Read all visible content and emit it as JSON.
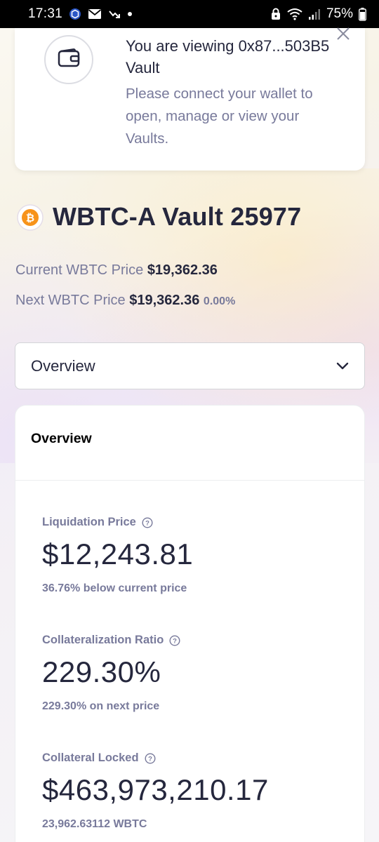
{
  "status_bar": {
    "time": "17:31",
    "battery": "75%",
    "icons": [
      "crypto-app-icon",
      "mail-icon",
      "missed-call-icon",
      "dot-icon",
      "lock-icon",
      "wifi-icon",
      "signal-icon",
      "battery-icon"
    ]
  },
  "notice": {
    "title": "You are viewing 0x87...503B5 Vault",
    "body": "Please connect your wallet to open, manage or view your Vaults."
  },
  "vault": {
    "title": "WBTC-A Vault 25977",
    "current_price_label": "Current WBTC Price",
    "current_price_value": "$19,362.36",
    "next_price_label": "Next WBTC Price",
    "next_price_value": "$19,362.36",
    "next_price_change": "0.00%"
  },
  "dropdown": {
    "selected": "Overview"
  },
  "overview": {
    "title": "Overview",
    "metrics": [
      {
        "label": "Liquidation Price",
        "value": "$12,243.81",
        "sub": "36.76% below current price"
      },
      {
        "label": "Collateralization Ratio",
        "value": "229.30%",
        "sub": "229.30% on next price"
      },
      {
        "label": "Collateral Locked",
        "value": "$463,973,210.17",
        "sub": "23,962.63112 WBTC"
      }
    ]
  },
  "colors": {
    "text_primary": "#25273d",
    "text_secondary": "#787a9b",
    "btc_orange": "#f7931a"
  }
}
